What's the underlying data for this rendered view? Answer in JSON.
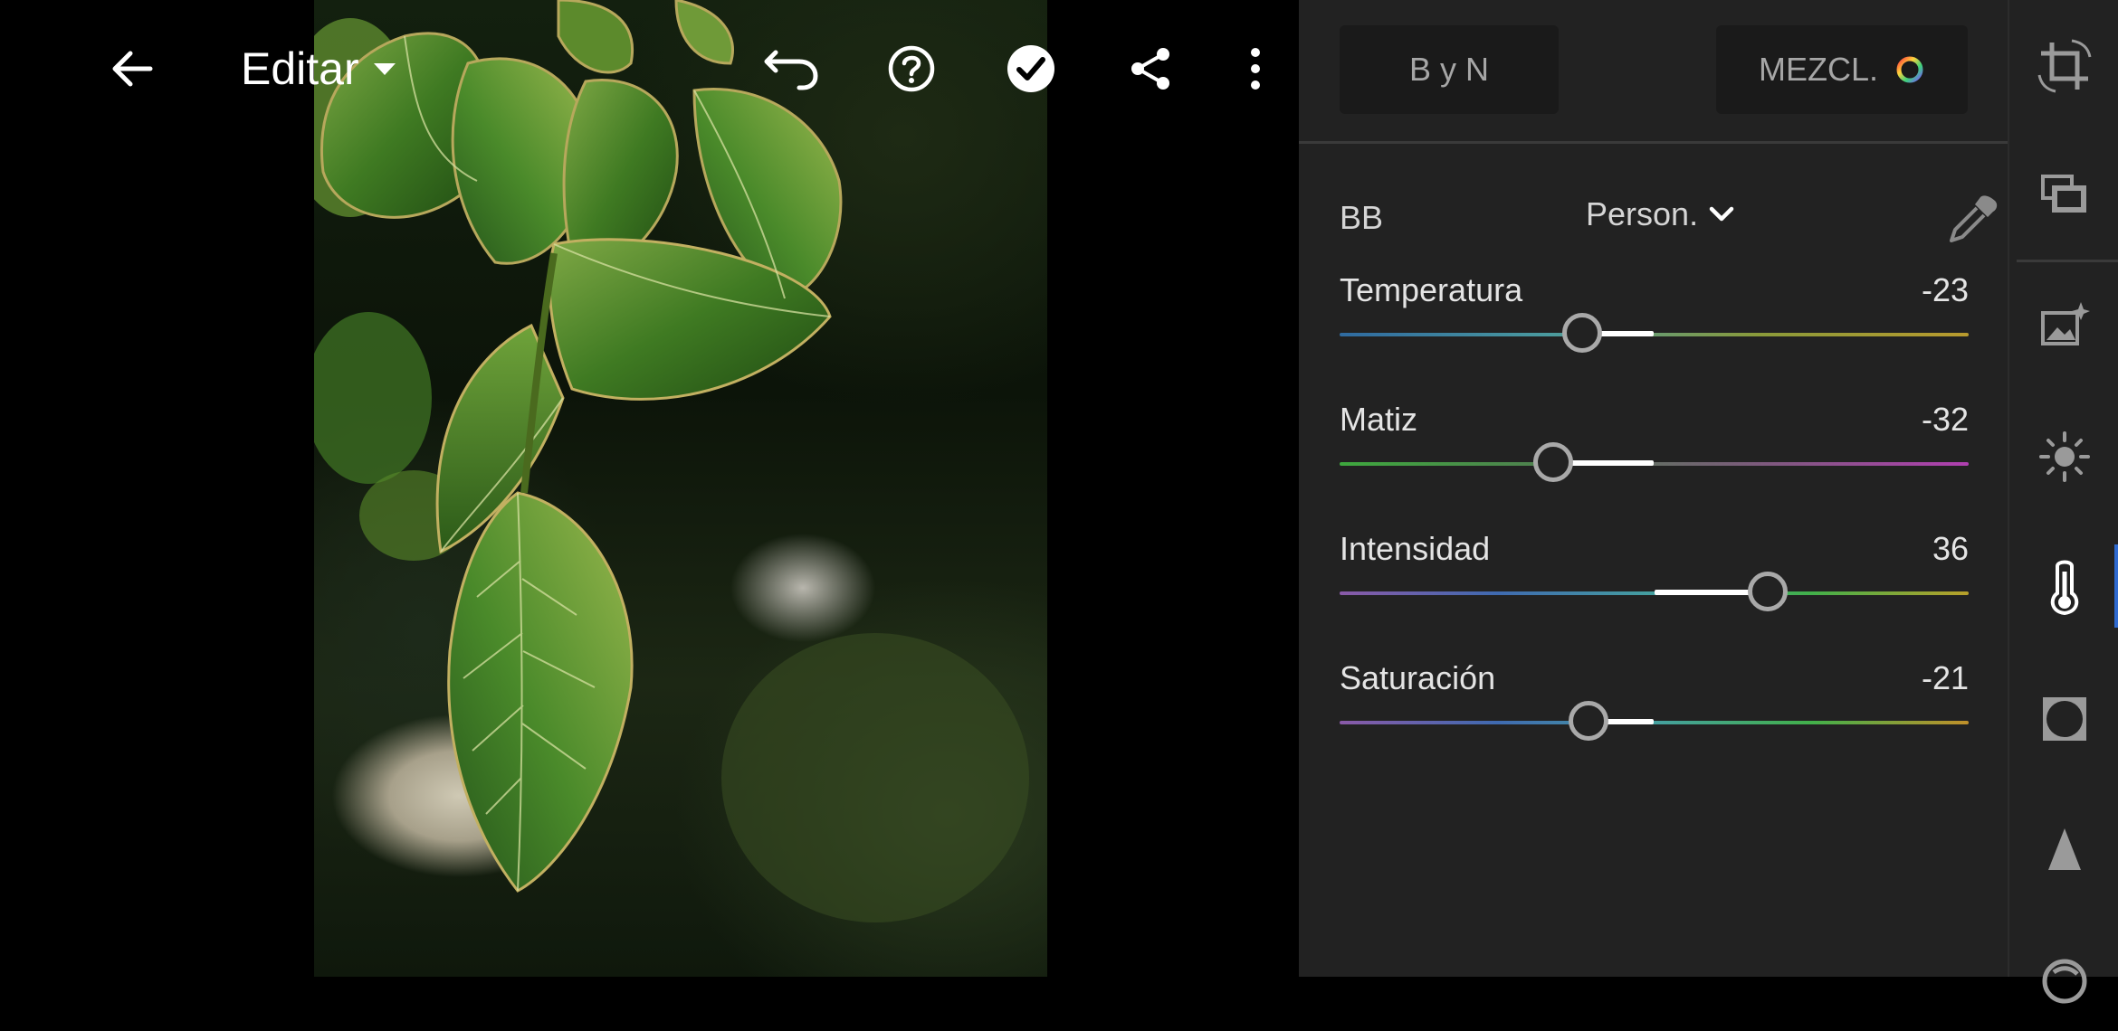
{
  "toolbar": {
    "title": "Editar",
    "icons": [
      "back-arrow-icon",
      "chevron-down-icon",
      "undo-icon",
      "help-icon",
      "done-check-icon",
      "share-icon",
      "more-vertical-icon"
    ]
  },
  "presets": {
    "bw_label": "B y N",
    "mix_label": "MEZCL."
  },
  "white_balance": {
    "label": "BB",
    "selected": "Person."
  },
  "sliders": [
    {
      "name": "Temperatura",
      "value_text": "-23",
      "value": -23,
      "min": -100,
      "max": 100,
      "gradient": [
        "#2f6aa0",
        "#4a9a9e",
        "#8a9a3a",
        "#b89a2e"
      ]
    },
    {
      "name": "Matiz",
      "value_text": "-32",
      "value": -32,
      "min": -100,
      "max": 100,
      "gradient": [
        "#3ea83e",
        "#4f7f4f",
        "#7c5a7c",
        "#b03fb0"
      ]
    },
    {
      "name": "Intensidad",
      "value_text": "36",
      "value": 36,
      "min": -100,
      "max": 100,
      "gradient": [
        "#8a5aa8",
        "#3f6ab0",
        "#45a0a0",
        "#42b04a",
        "#b8a02a"
      ]
    },
    {
      "name": "Saturación",
      "value_text": "-21",
      "value": -21,
      "min": -100,
      "max": 100,
      "gradient": [
        "#8a5aa8",
        "#3f6ab0",
        "#45a0a0",
        "#42b04a",
        "#c0902a"
      ]
    }
  ],
  "rail": {
    "active": "color-temperature-icon",
    "icons": [
      "crop-rotate-icon",
      "versions-icon",
      "auto-enhance-icon",
      "light-icon",
      "color-temperature-icon",
      "vignette-effects-icon",
      "detail-icon",
      "optics-icon"
    ]
  },
  "colors": {
    "panel": "#222222",
    "accent": "#2f6ad0",
    "thumb_ring": "#a9a9a9"
  }
}
